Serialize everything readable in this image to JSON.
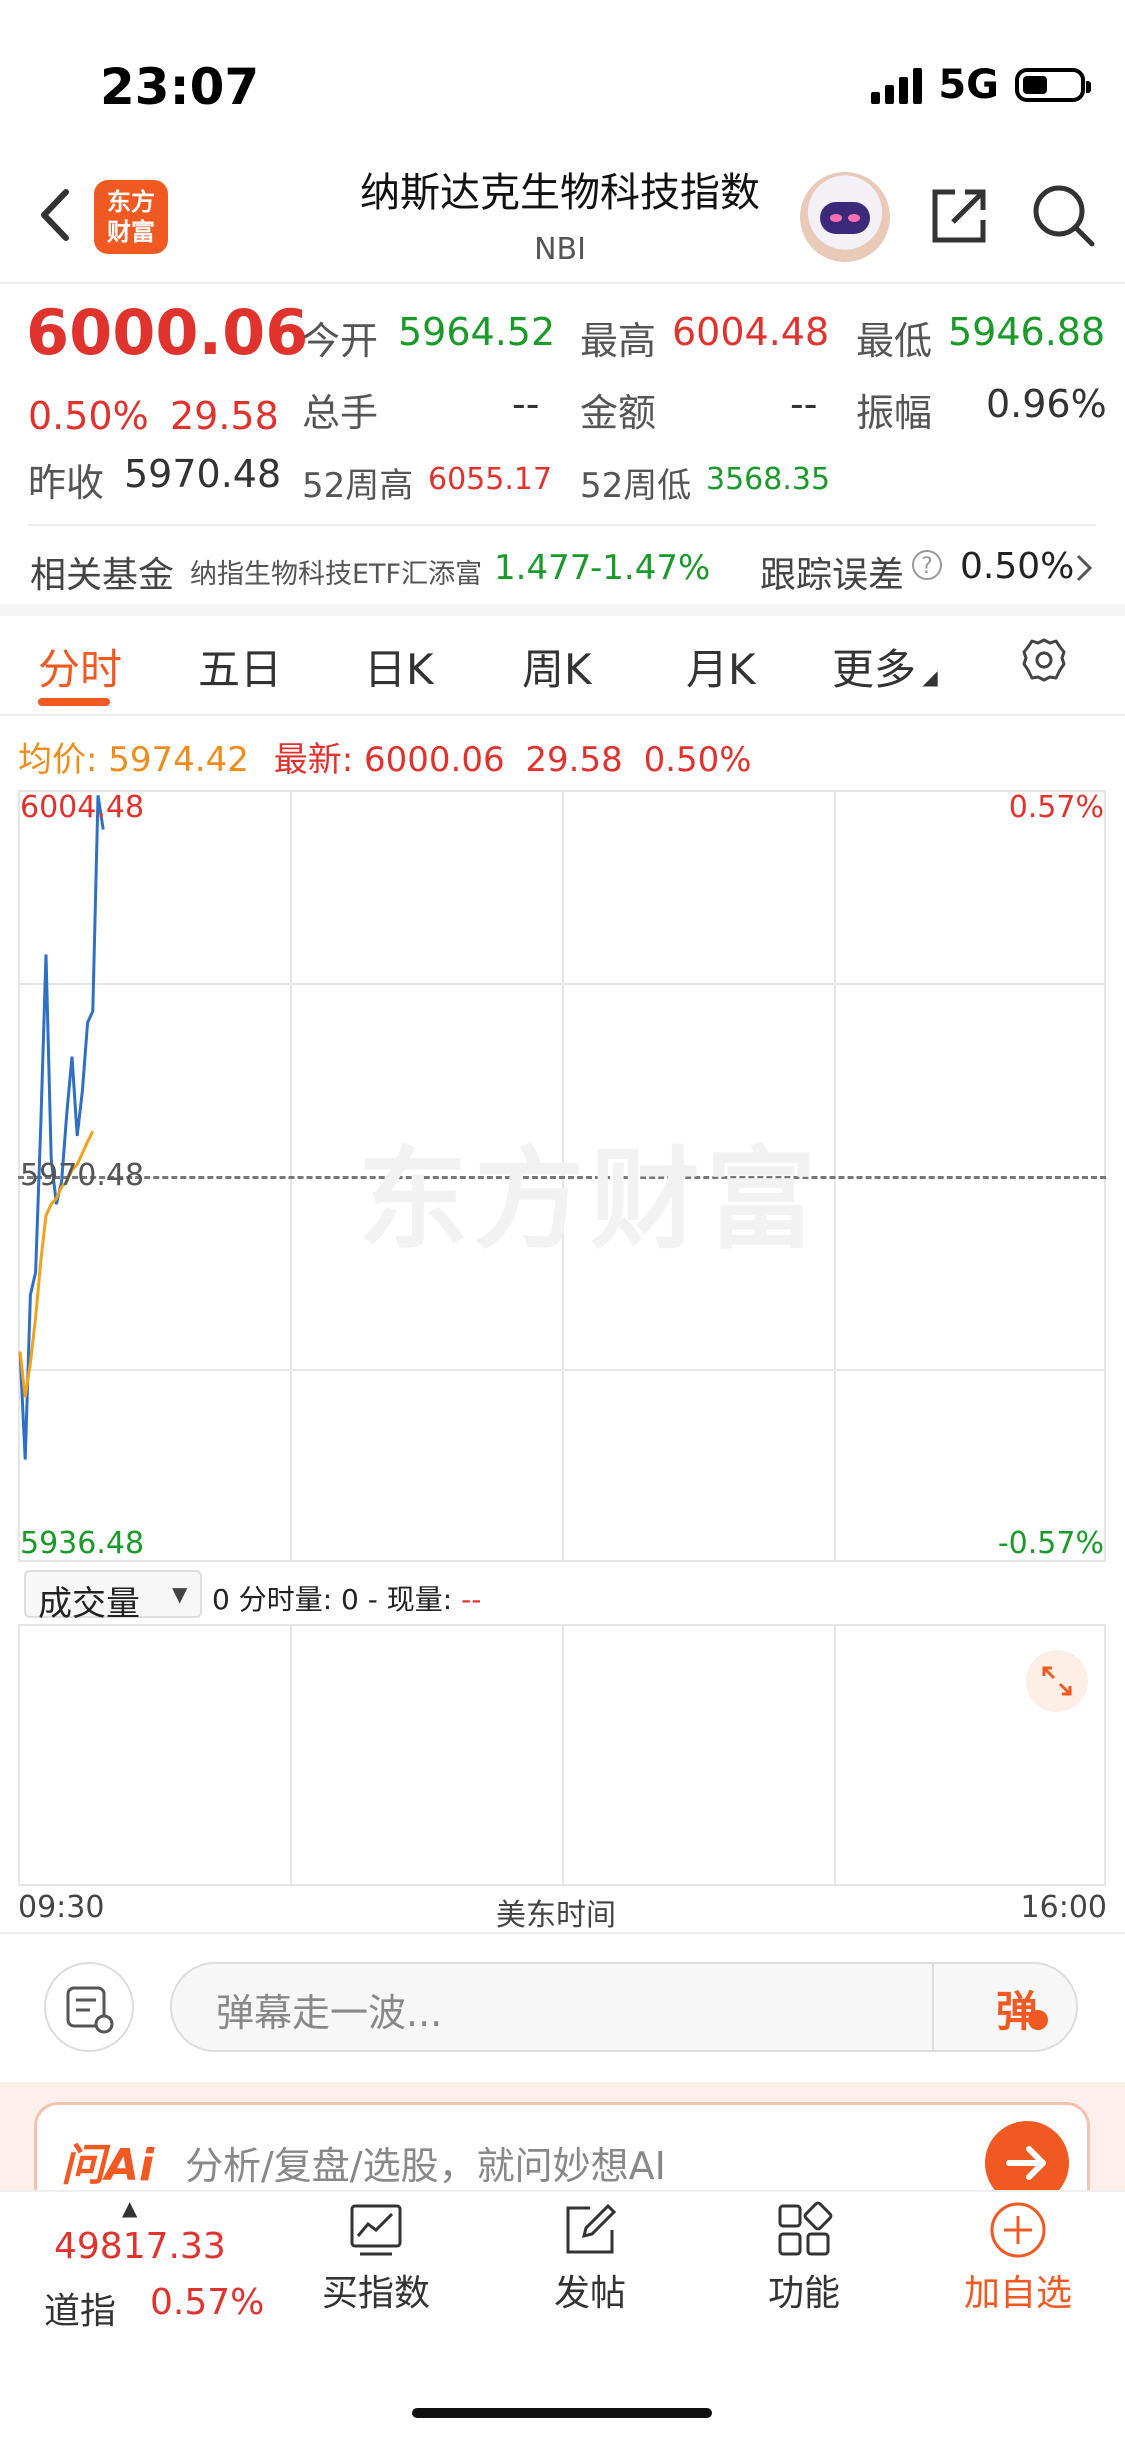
{
  "status_bar": {
    "time": "23:07",
    "network": "5G"
  },
  "header": {
    "title": "纳斯达克生物科技指数",
    "subtitle": "NBI",
    "logo_text_line1": "东方",
    "logo_text_line2": "财富"
  },
  "quote": {
    "price": "6000.06",
    "change_pct": "0.50%",
    "change_val": "29.58",
    "prev_close_label": "昨收",
    "prev_close": "5970.48",
    "open_label": "今开",
    "open": "5964.52",
    "high_label": "最高",
    "high": "6004.48",
    "low_label": "最低",
    "low": "5946.88",
    "volume_label": "总手",
    "volume": "--",
    "amount_label": "金额",
    "amount": "--",
    "amplitude_label": "振幅",
    "amplitude": "0.96%",
    "wk52_high_label": "52周高",
    "wk52_high": "6055.17",
    "wk52_low_label": "52周低",
    "wk52_low": "3568.35"
  },
  "fund": {
    "label": "相关基金",
    "name": "纳指生物科技ETF汇添富",
    "price": "1.477",
    "change": "-1.47%",
    "tracking_label": "跟踪误差",
    "tracking_value": "0.50%"
  },
  "tabs": [
    "分时",
    "五日",
    "日K",
    "周K",
    "月K",
    "更多"
  ],
  "avg_line": {
    "avg_label": "均价:",
    "avg_value": "5974.42",
    "latest_label": "最新:",
    "latest_value": "6000.06",
    "latest_change": "29.58",
    "latest_pct": "0.50%"
  },
  "chart": {
    "y_top": "6004.48",
    "y_mid": "5970.48",
    "y_bottom": "5936.48",
    "pct_top": "0.57%",
    "pct_bottom": "-0.57%",
    "watermark": "东方财富",
    "price_color": "#2f6fc4",
    "avg_color": "#f0a21c"
  },
  "chart_data": {
    "type": "line",
    "ylim": [
      5936.48,
      6004.48
    ],
    "baseline": 5970.48,
    "x_start": "09:30",
    "x_end": "16:00",
    "x_axis_label": "美东时间",
    "series": [
      {
        "values": [
          5955.0,
          5945.5,
          5960.0,
          5962.0,
          5975.0,
          5990.0,
          5972.0,
          5968.0,
          5970.0,
          5976.0,
          5981.0,
          5974.0,
          5978.0,
          5984.0,
          5985.0,
          6004.0,
          6001.0
        ]
      },
      {
        "values": [
          5955.0,
          5951.0,
          5954.0,
          5958.0,
          5963.0,
          5967.0,
          5968.0,
          5968.5,
          5969.5,
          5970.0,
          5971.0,
          5971.5,
          5972.5,
          5973.5,
          5974.42
        ]
      }
    ]
  },
  "volume": {
    "selector_label": "成交量",
    "info_text": "0 分时量: 0 - 现量:",
    "info_dash": "--"
  },
  "danmu": {
    "placeholder": "弹幕走一波...",
    "send_label": "弹"
  },
  "ai": {
    "logo": "问Ai",
    "prompt": "分析/复盘/选股，就问妙想AI"
  },
  "bottom_nav": {
    "index_value": "49817.33",
    "index_name": "道指",
    "index_pct": "0.57%",
    "items": [
      {
        "label": "买指数",
        "icon": "chart-icon"
      },
      {
        "label": "发帖",
        "icon": "edit-icon"
      },
      {
        "label": "功能",
        "icon": "grid-icon"
      },
      {
        "label": "加自选",
        "icon": "plus-circle-icon"
      }
    ]
  }
}
